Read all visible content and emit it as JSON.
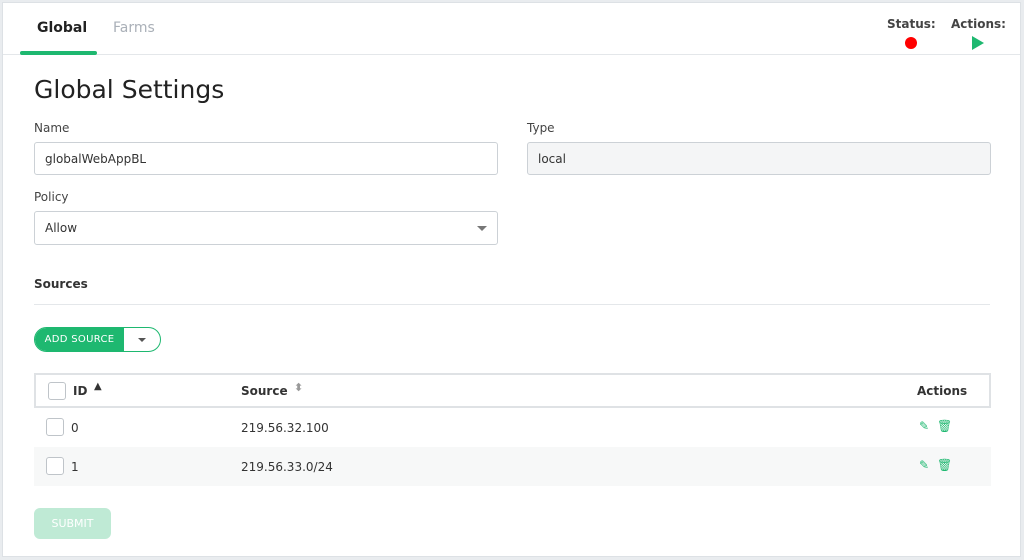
{
  "tabs": [
    {
      "label": "Global"
    },
    {
      "label": "Farms"
    }
  ],
  "header": {
    "status_label": "Status:",
    "status_color": "#ff0000",
    "actions_label": "Actions:",
    "actions_icon": "play-icon"
  },
  "page_title": "Global Settings",
  "form": {
    "name": {
      "label": "Name",
      "value": "globalWebAppBL"
    },
    "type": {
      "label": "Type",
      "value": "local"
    },
    "policy": {
      "label": "Policy",
      "value": "Allow"
    }
  },
  "sources": {
    "title": "Sources",
    "add_label": "ADD SOURCE",
    "columns": [
      "ID",
      "Source",
      "Actions"
    ],
    "rows": [
      {
        "id": "0",
        "source": "219.56.32.100"
      },
      {
        "id": "1",
        "source": "219.56.33.0/24"
      }
    ]
  },
  "submit_label": "SUBMIT",
  "colors": {
    "accent": "#1eb870"
  }
}
